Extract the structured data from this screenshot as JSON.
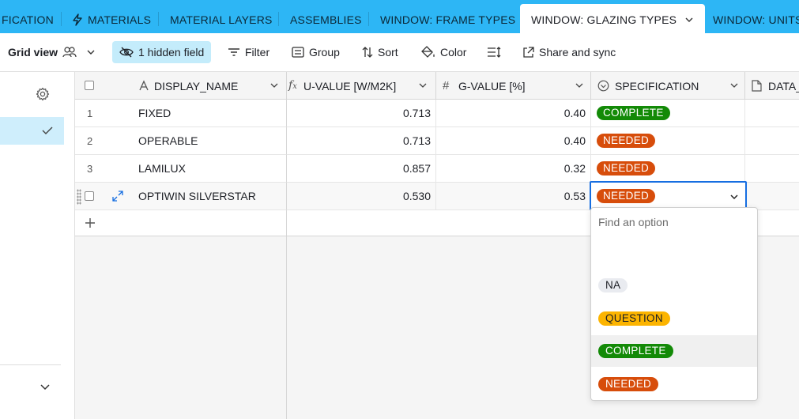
{
  "tabs": [
    {
      "label": "FICATION",
      "active": false
    },
    {
      "label": "MATERIALS",
      "active": false,
      "icon": "bolt-icon"
    },
    {
      "label": "MATERIAL LAYERS",
      "active": false
    },
    {
      "label": "ASSEMBLIES",
      "active": false
    },
    {
      "label": "WINDOW: FRAME TYPES",
      "active": false
    },
    {
      "label": "WINDOW: GLAZING TYPES",
      "active": true
    },
    {
      "label": "WINDOW: UNITS",
      "active": false
    }
  ],
  "toolbar": {
    "view_label": "Grid view",
    "hidden_label": "1 hidden field",
    "filter_label": "Filter",
    "group_label": "Group",
    "sort_label": "Sort",
    "color_label": "Color",
    "share_label": "Share and sync"
  },
  "grid": {
    "headers": {
      "display_name": "DISPLAY_NAME",
      "u_value": "U-VALUE [W/M2K]",
      "g_value": "G-VALUE [%]",
      "specification": "SPECIFICATION",
      "data": "DATA_"
    },
    "rows": [
      {
        "num": "1",
        "name": "FIXED",
        "u": "0.713",
        "g": "0.40",
        "spec": "COMPLETE"
      },
      {
        "num": "2",
        "name": "OPERABLE",
        "u": "0.713",
        "g": "0.40",
        "spec": "NEEDED"
      },
      {
        "num": "3",
        "name": "LAMILUX",
        "u": "0.857",
        "g": "0.32",
        "spec": "NEEDED"
      },
      {
        "num": "",
        "name": "OPTIWIN SILVERSTAR",
        "u": "0.530",
        "g": "0.53",
        "spec": "NEEDED"
      }
    ]
  },
  "dropdown": {
    "search_placeholder": "Find an option",
    "options": [
      {
        "label": "NA",
        "bg": "#e9ebf0",
        "fg": "#1d1f25"
      },
      {
        "label": "QUESTION",
        "bg": "#fcb400",
        "fg": "#1d1f25"
      },
      {
        "label": "COMPLETE",
        "bg": "#138a07",
        "fg": "#ffffff"
      },
      {
        "label": "NEEDED",
        "bg": "#d74d0b",
        "fg": "#ffffff"
      }
    ]
  },
  "colors": {
    "tab_bar": "#2db6f5",
    "complete": "#138a07",
    "needed": "#d74d0b",
    "selection_border": "#166ee1"
  }
}
